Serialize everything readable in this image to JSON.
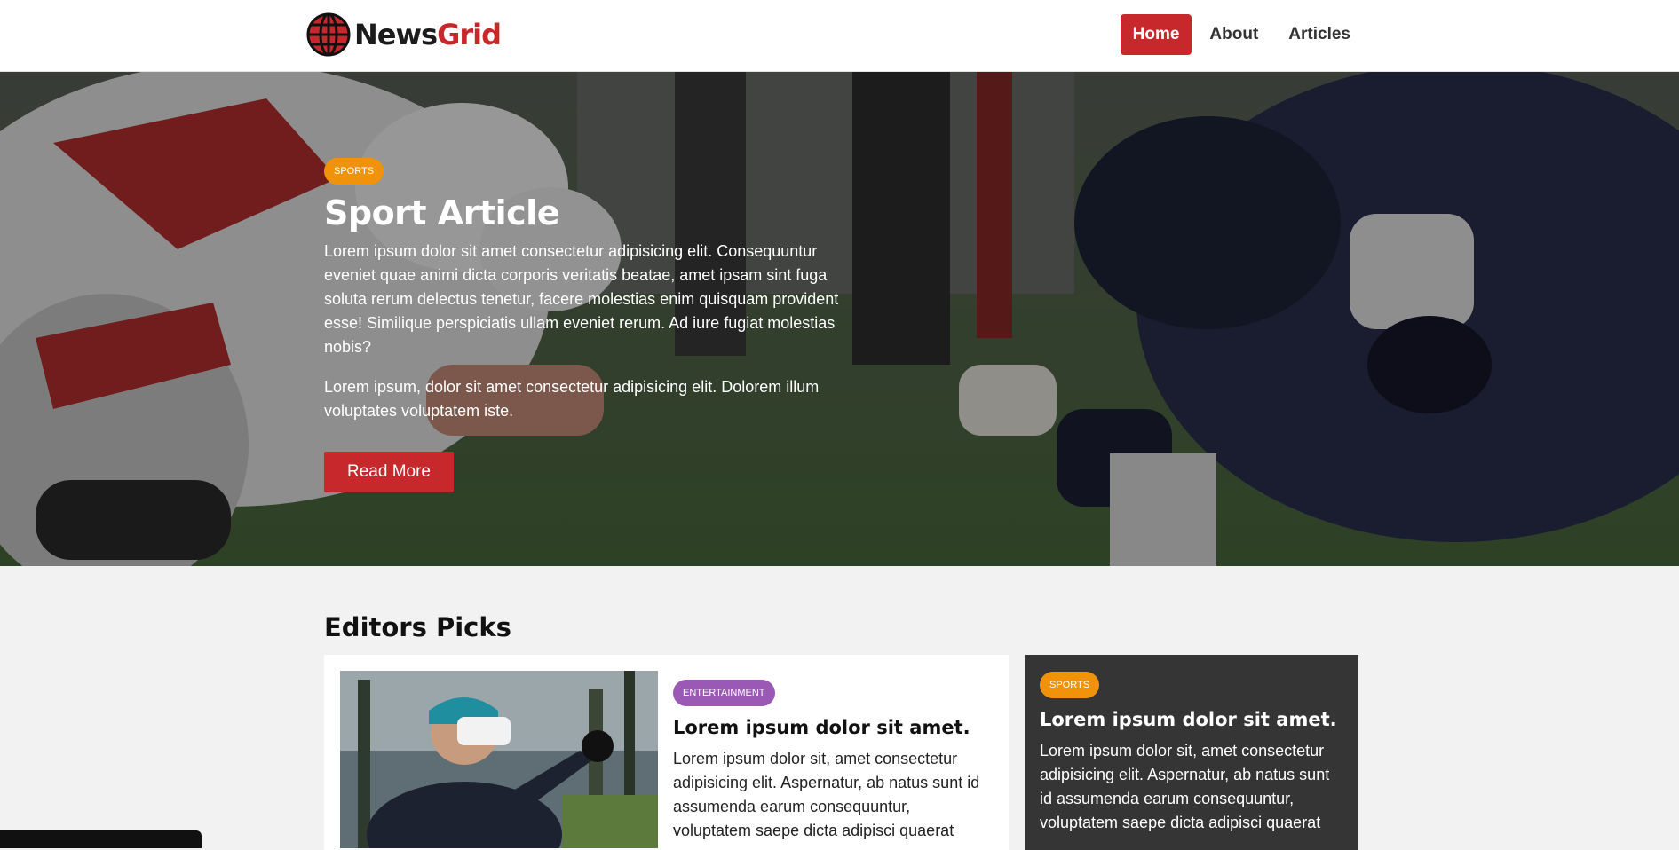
{
  "brand": {
    "name_part1": "News",
    "name_part2": "Grid",
    "icon": "globe-icon"
  },
  "nav": {
    "items": [
      {
        "label": "Home",
        "active": true
      },
      {
        "label": "About",
        "active": false
      },
      {
        "label": "Articles",
        "active": false
      }
    ]
  },
  "hero": {
    "tag": "SPORTS",
    "title": "Sport Article",
    "paragraph1": "Lorem ipsum dolor sit amet consectetur adipisicing elit. Consequuntur eveniet quae animi dicta corporis veritatis beatae, amet ipsam sint fuga soluta rerum delectus tenetur, facere molestias enim quisquam provident esse! Similique perspiciatis ullam eveniet rerum. Ad iure fugiat molestias nobis?",
    "paragraph2": "Lorem ipsum, dolor sit amet consectetur adipisicing elit. Dolorem illum voluptates voluptatem iste.",
    "button_label": "Read More"
  },
  "editors_picks": {
    "heading": "Editors Picks",
    "main_card": {
      "tag": "ENTERTAINMENT",
      "title": "Lorem ipsum dolor sit amet.",
      "text": "Lorem ipsum dolor sit, amet consectetur adipisicing elit. Aspernatur, ab natus sunt id assumenda earum consequuntur, voluptatem saepe dicta adipisci quaerat"
    },
    "side_card": {
      "tag": "SPORTS",
      "title": "Lorem ipsum dolor sit amet.",
      "text": "Lorem ipsum dolor sit, amet consectetur adipisicing elit. Aspernatur, ab natus sunt id assumenda earum consequuntur, voluptatem saepe dicta adipisci quaerat"
    }
  },
  "colors": {
    "accent": "#c7282c",
    "tag_sports": "#f0930a",
    "tag_entertainment": "#9b59b6",
    "side_card_bg": "#353535"
  }
}
